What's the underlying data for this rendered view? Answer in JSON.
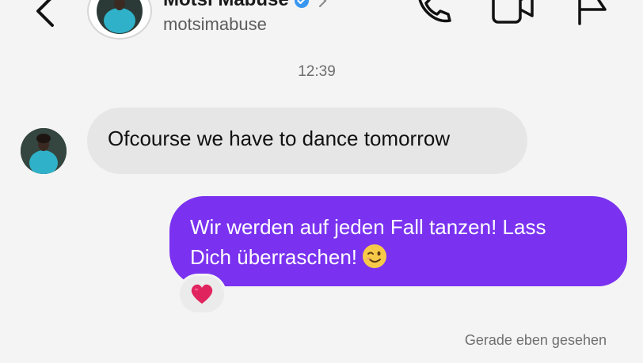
{
  "header": {
    "name": "Motsi Mabuse",
    "handle": "motsimabuse",
    "back_icon": "chevron-left-icon",
    "verified_icon": "verified-badge-icon",
    "actions": [
      "phone-icon",
      "video-camera-icon",
      "flag-icon"
    ]
  },
  "conversation": {
    "timestamp": "12:39",
    "messages": [
      {
        "direction": "incoming",
        "text": "Ofcourse we have to dance tomorrow"
      },
      {
        "direction": "outgoing",
        "line1": "Wir werden auf jeden Fall tanzen! Lass",
        "line2": "Dich überraschen!",
        "emoji": "winking-face-icon",
        "reaction": "red-heart-icon"
      }
    ],
    "seen_status": "Gerade eben gesehen"
  },
  "colors": {
    "background": "#f4f4f4",
    "incoming_bubble": "#e6e6e6",
    "outgoing_bubble": "#7a32f0",
    "verified": "#3897f0",
    "heart": "#e0245e"
  }
}
